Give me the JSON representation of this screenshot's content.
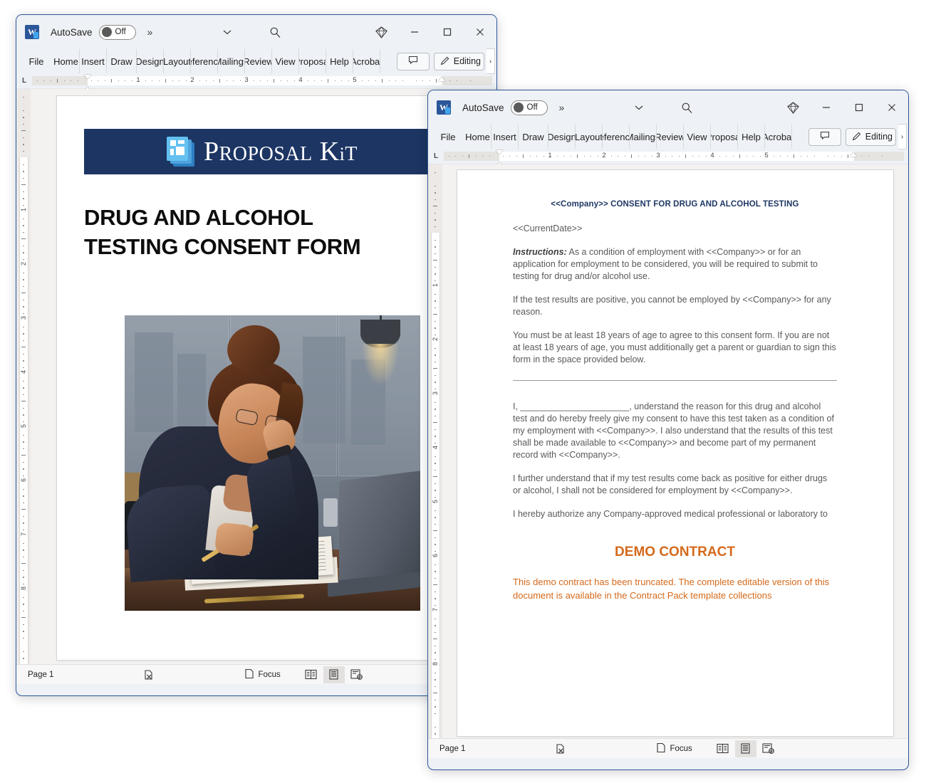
{
  "window1": {
    "titlebar": {
      "app_icon": "word-icon",
      "autosave_label": "AutoSave",
      "autosave_state": "Off",
      "more_commands": "»",
      "customize_icon": "chevron-down-icon",
      "search_icon": "search-icon",
      "copilot_icon": "copilot-diamond-icon",
      "minimize_icon": "minimize-icon",
      "maximize_icon": "maximize-icon",
      "close_icon": "close-icon"
    },
    "ribbon": {
      "tabs": [
        "File",
        "Home",
        "Insert",
        "Draw",
        "Design",
        "Layout",
        "References",
        "Mailings",
        "Review",
        "View",
        "Proposal",
        "Help",
        "Acrobat"
      ],
      "comment_icon": "comment-icon",
      "editing_icon": "pencil-icon",
      "editing_label": "Editing",
      "overflow_label": "›"
    },
    "ruler": {
      "tab_stop": "L",
      "numbers": [
        "1",
        "2",
        "3",
        "4",
        "5"
      ],
      "vertical_numbers": [
        "1",
        "2",
        "3",
        "4",
        "5",
        "6",
        "7",
        "8"
      ]
    },
    "document": {
      "banner_color": "#1c3563",
      "logo_text_1": "P",
      "logo_text_2": "ROPOSAL",
      "logo_text_3": "K",
      "logo_text_4": "i",
      "logo_text_5": "T",
      "title_line1": "DRUG AND ALCOHOL",
      "title_line2": "TESTING CONSENT FORM",
      "image_alt": "businesswoman-at-desk-illustration"
    },
    "statusbar": {
      "page": "Page 1",
      "spell_icon": "spelling-check-icon",
      "focus_icon": "focus-icon",
      "focus_label": "Focus",
      "view_read": "read-mode-icon",
      "view_print": "print-layout-icon",
      "view_web": "web-layout-icon"
    }
  },
  "window2": {
    "titlebar": {
      "app_icon": "word-icon",
      "autosave_label": "AutoSave",
      "autosave_state": "Off",
      "more_commands": "»",
      "customize_icon": "chevron-down-icon",
      "search_icon": "search-icon",
      "copilot_icon": "copilot-diamond-icon",
      "minimize_icon": "minimize-icon",
      "maximize_icon": "maximize-icon",
      "close_icon": "close-icon"
    },
    "ribbon": {
      "tabs": [
        "File",
        "Home",
        "Insert",
        "Draw",
        "Design",
        "Layout",
        "References",
        "Mailings",
        "Review",
        "View",
        "Proposal",
        "Help",
        "Acrobat"
      ],
      "comment_icon": "comment-icon",
      "editing_icon": "pencil-icon",
      "editing_label": "Editing",
      "overflow_label": "›"
    },
    "ruler": {
      "tab_stop": "L",
      "numbers": [
        "1",
        "2",
        "3",
        "4",
        "5"
      ],
      "vertical_numbers": [
        "1",
        "2",
        "3",
        "4",
        "5",
        "6",
        "7",
        "8"
      ]
    },
    "document": {
      "heading": "<<Company>> CONSENT FOR DRUG AND ALCOHOL TESTING",
      "date_field": "<<CurrentDate>>",
      "p1_label": "Instructions:",
      "p1_body": " As a condition of employment with <<Company>> or for an application for employment to be considered, you will be required to submit to testing for drug and/or alcohol use.",
      "p2": "If the test results are positive, you cannot be employed by <<Company>> for any reason.",
      "p3": "You must be at least 18 years of age to agree to this consent form. If you are not at least 18 years of age, you must additionally get a parent or guardian to sign this form in the space provided below.",
      "p4": "I, ______________________, understand the reason for this drug and alcohol test and do hereby freely give my consent to have this test taken as a condition of my employment with <<Company>>. I also understand that the results of this test shall be made available to <<Company>> and become part of my permanent record with <<Company>>.",
      "p5": "I further understand that if my test results come back as positive for either drugs or alcohol, I shall not be considered for employment by <<Company>>.",
      "p6": "I hereby authorize any Company-approved medical professional or laboratory to",
      "demo_title": "DEMO CONTRACT",
      "demo_text": "This demo contract has been truncated. The complete editable version of this document is available in the Contract Pack template collections",
      "demo_color": "#d4691b",
      "heading_color": "#1f3864"
    },
    "statusbar": {
      "page": "Page 1",
      "spell_icon": "spelling-check-icon",
      "focus_icon": "focus-icon",
      "focus_label": "Focus",
      "view_read": "read-mode-icon",
      "view_print": "print-layout-icon",
      "view_web": "web-layout-icon"
    }
  }
}
